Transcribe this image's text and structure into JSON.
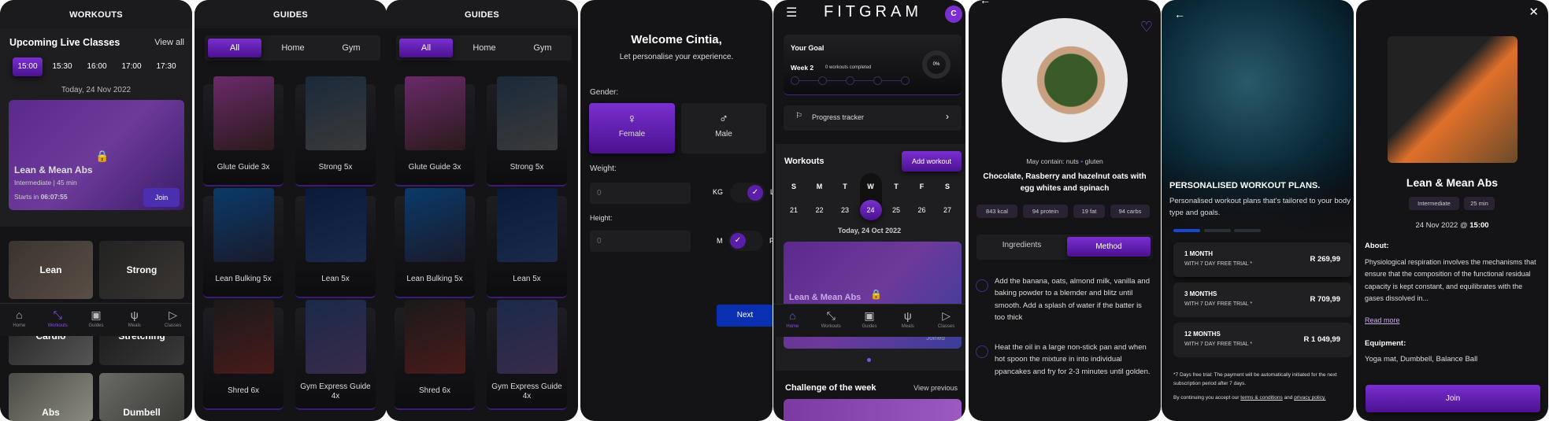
{
  "colors": {
    "accent": "#6a24c0",
    "next_button": "#0a2fb0",
    "background": "#141416"
  },
  "workouts": {
    "title": "WORKOUTS",
    "section_title": "Upcoming Live Classes",
    "view_all": "View all",
    "times": [
      "15:00",
      "15:30",
      "16:00",
      "17:00",
      "17:30"
    ],
    "selected_time": "15:00",
    "date": "Today, 24 Nov 2022",
    "live_card": {
      "title": "Lean & Mean Abs",
      "meta": "Intermediate | 45 min",
      "starts_label": "Starts in",
      "countdown": "06:07:55",
      "join": "Join",
      "icon": "lock-icon"
    },
    "categories": [
      "Lean",
      "Strong",
      "Cardio",
      "Stretching",
      "Abs",
      "Dumbell"
    ]
  },
  "nav": [
    {
      "label": "Home",
      "icon": "home-icon"
    },
    {
      "label": "Workouts",
      "icon": "dumbbell-icon"
    },
    {
      "label": "Guides",
      "icon": "clipboard-icon"
    },
    {
      "label": "Meals",
      "icon": "utensils-icon"
    },
    {
      "label": "Classes",
      "icon": "play-circle-icon"
    }
  ],
  "guides": {
    "title": "GUIDES",
    "tabs": [
      "All",
      "Home",
      "Gym"
    ],
    "active_tab": "All",
    "items": [
      "Glute Guide 3x",
      "Strong 5x",
      "Lean Bulking 5x",
      "Lean 5x",
      "Shred 6x",
      "Gym Express Guide 4x"
    ]
  },
  "onboarding": {
    "title": "Welcome Cintia,",
    "subtitle": "Let personalise your experience.",
    "gender_label": "Gender:",
    "female": "Female",
    "male": "Male",
    "selected_gender": "Female",
    "weight_label": "Weight:",
    "weight_placeholder": "0",
    "weight_units": [
      "KG",
      "LB"
    ],
    "weight_unit_selected": "LB",
    "height_label": "Height:",
    "height_placeholder": "0",
    "height_units": [
      "M",
      "FT"
    ],
    "height_unit_selected": "M",
    "next": "Next"
  },
  "home": {
    "logo": "FITGRAM",
    "avatar": "C",
    "goal_title": "Your Goal",
    "week": "Week 2",
    "workouts_completed": "0 workouts completed",
    "progress_percent": "0%",
    "progress_tracker": "Progress tracker",
    "workouts_title": "Workouts",
    "add_workout": "Add workout",
    "weekdays": [
      "S",
      "M",
      "T",
      "W",
      "T",
      "F",
      "S"
    ],
    "dates": [
      "21",
      "22",
      "23",
      "24",
      "25",
      "26",
      "27"
    ],
    "selected_date": "24",
    "today": "Today, 24 Oct 2022",
    "card_title": "Lean & Mean Abs",
    "card_button": "Joined",
    "challenge_title": "Challenge of the week",
    "view_previous": "View previous"
  },
  "recipe": {
    "may_contain_label": "May contain:",
    "allergens": [
      "nuts",
      "gluten"
    ],
    "title": "Chocolate, Rasberry and hazelnut oats with egg whites and spinach",
    "chips": [
      "843 kcal",
      "94 protein",
      "19 fat",
      "94 carbs"
    ],
    "tabs": [
      "Ingredients",
      "Method"
    ],
    "active_tab": "Method",
    "steps": [
      "Add the banana, oats, almond milk, vanilla and baking powder to a blemder and blitz until smooth. Add a splash of water if the batter is too thick",
      "Heat the oil in a large non-stick pan and when hot spoon the mixture in into individual ppancakes and fry for 2-3 minutes until golden."
    ]
  },
  "subscription": {
    "headline": "PERSONALISED WORKOUT PLANS.",
    "subtitle": "Personalised workout plans that's tailored to your body type and goals.",
    "plans": [
      {
        "title": "1 MONTH",
        "trial": "WITH 7 DAY FREE TRIAL *",
        "price": "R 269,99",
        "selected": true
      },
      {
        "title": "3 MONTHS",
        "trial": "WITH 7 DAY FREE TRIAL *",
        "price": "R 709,99",
        "selected": false
      },
      {
        "title": "12 MONTHS",
        "trial": "WITH 7 DAY FREE TRIAL *",
        "price": "R 1 049,99",
        "selected": false
      }
    ],
    "footnote": "*7 Days free trial: The payment will be automatically initiated for the next subscription period after 7 days.",
    "terms_prefix": "By continuing you accept our",
    "terms_link": "terms & conditions",
    "terms_and": "and",
    "privacy_link": "privacy policy."
  },
  "class_detail": {
    "title": "Lean & Mean Abs",
    "chips": [
      "Intermediate",
      "25 min"
    ],
    "date": "24 Nov 2022 @",
    "time": "15:00",
    "about_label": "About:",
    "about": "Physiological respiration involves the mechanisms that ensure that the composition of the functional residual capacity is kept constant, and equilibrates with the gases dissolved in...",
    "read_more": "Read more",
    "equipment_label": "Equipment:",
    "equipment": "Yoga mat, Dumbbell, Balance Ball",
    "join": "Join"
  }
}
